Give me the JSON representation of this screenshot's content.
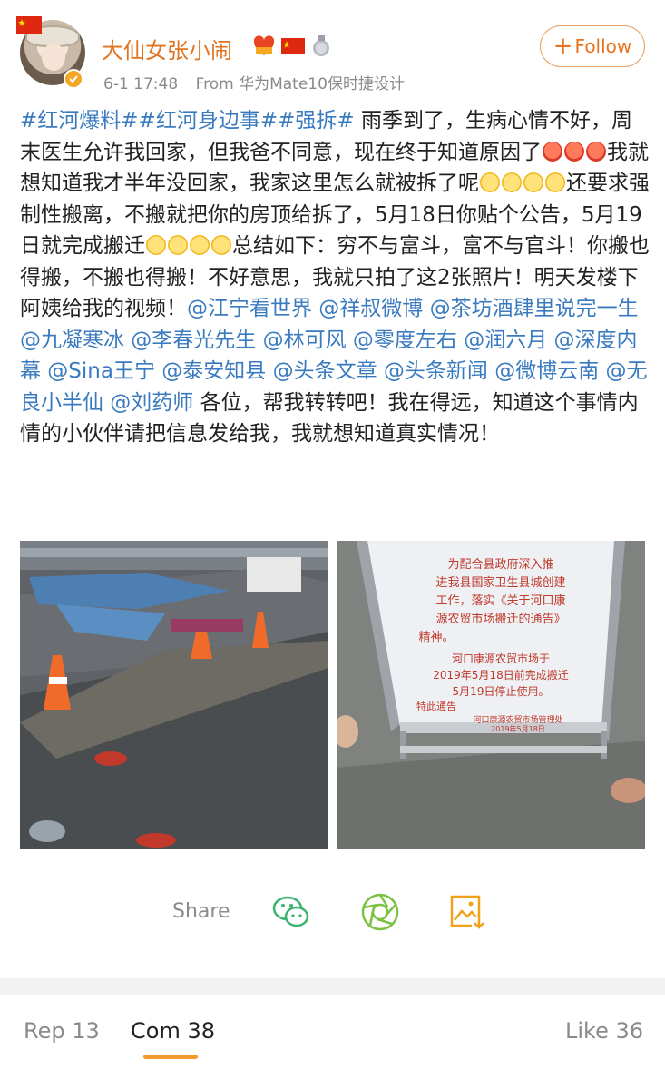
{
  "post": {
    "author": "大仙女张小闹",
    "timestamp": "6-1 17:48",
    "source": "From 华为Mate10保时捷设计",
    "follow_label": "Follow",
    "text": {
      "topics": "#红河爆料##红河身边事##强拆#",
      "p1": " 雨季到了，生病心情不好，周末医生允许我回家，但我爸不同意，现在终于知道原因了",
      "p2": "我就想知道我才半年没回家，我家这里怎么就被拆了呢",
      "p3": "还要求强制性搬离，不搬就把你的房顶给拆了，5月18日你贴个公告，5月19日就完成搬迁",
      "p4": "总结如下：穷不与富斗，富不与官斗！你搬也得搬，不搬也得搬！不好意思，我就只拍了这2张照片！明天发楼下阿姨给我的视频！",
      "mentions": "@江宁看世界 @祥叔微博 @茶坊酒肆里说完一生 @九凝寒冰 @李春光先生 @林可风 @零度左右 @润六月 @深度内幕 @Sina王宁 @泰安知县 @头条文章 @头条新闻 @微博云南 @无良小半仙 @刘药师",
      "p5": " 各位，帮我转转吧！我在得远，知道这个事情内情的小伙伴请把信息发给我，我就想知道真实情况！"
    }
  },
  "notice": {
    "lines": [
      "为配合县政府深入推",
      "进我县国家卫生县城创建",
      "工作，落实《关于河口康",
      "源农贸市场搬迁的通告》",
      "精神。",
      "河口康源农贸市场于",
      "2019年5月18日前完成搬迁",
      "5月19日停止使用。",
      "特此通告",
      "河口康源农贸市场管理处",
      "2019年5月18日"
    ]
  },
  "share": {
    "label": "Share"
  },
  "tabs": [
    {
      "label": "Rep 13",
      "active": false
    },
    {
      "label": "Com 38",
      "active": true
    },
    {
      "label": "Like 36",
      "active": false
    }
  ],
  "icons": [
    "china-flag-icon",
    "verified-icon",
    "vip-icon",
    "medal-icon",
    "wechat-icon",
    "moments-icon",
    "save-image-icon"
  ],
  "colors": {
    "accent": "#e8731f",
    "link": "#3a7bbf",
    "tab_indicator": "#f29a2e"
  }
}
